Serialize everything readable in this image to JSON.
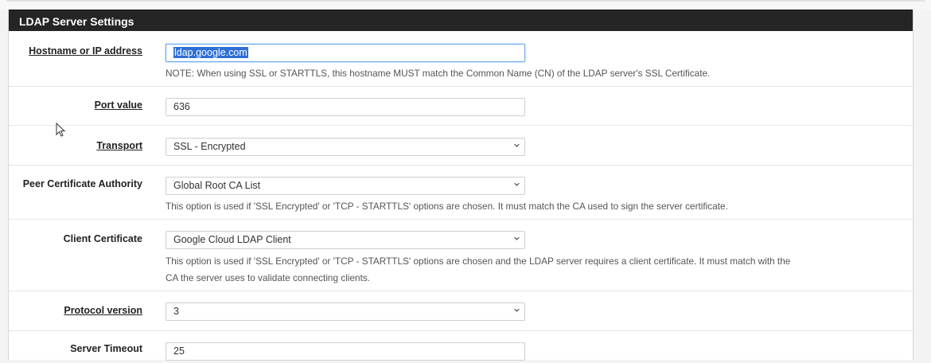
{
  "panel": {
    "title": "LDAP Server Settings"
  },
  "fields": {
    "hostname": {
      "label": "Hostname or IP address",
      "value": "ldap.google.com",
      "note": "NOTE: When using SSL or STARTTLS, this hostname MUST match the Common Name (CN) of the LDAP server's SSL Certificate."
    },
    "port": {
      "label": "Port value",
      "value": "636"
    },
    "transport": {
      "label": "Transport",
      "value": "SSL - Encrypted"
    },
    "peer_ca": {
      "label": "Peer Certificate Authority",
      "value": "Global Root CA List",
      "help": "This option is used if 'SSL Encrypted' or 'TCP - STARTTLS' options are chosen. It must match the CA used to sign the server certificate."
    },
    "client_cert": {
      "label": "Client Certificate",
      "value": "Google Cloud LDAP Client",
      "help_line1": "This option is used if 'SSL Encrypted' or 'TCP - STARTTLS' options are chosen and the LDAP server requires a client certificate. It must match with the",
      "help_line2": "CA the server uses to validate connecting clients."
    },
    "protocol": {
      "label": "Protocol version",
      "value": "3"
    },
    "timeout": {
      "label": "Server Timeout",
      "value": "25"
    }
  },
  "icons": {
    "dropdown": "chevron-down-icon",
    "pointer": "mouse-pointer-icon"
  }
}
